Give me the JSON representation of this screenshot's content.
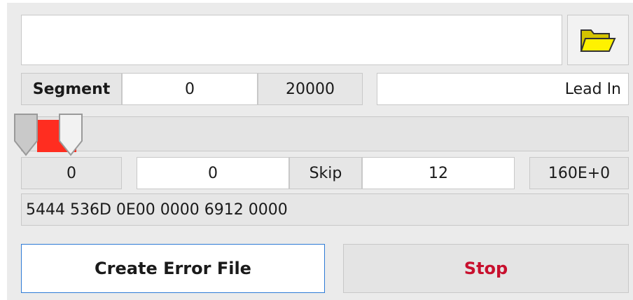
{
  "file": {
    "path_value": "",
    "browse_icon": "folder-open-icon"
  },
  "segment": {
    "label": "Segment",
    "start": "0",
    "end": "20000",
    "mode": "Lead In"
  },
  "slider": {
    "fill_color": "#ff2d20"
  },
  "position": {
    "value_a": "0",
    "value_b": "0",
    "skip_label": "Skip",
    "skip_count": "12",
    "rate": "160E+0"
  },
  "hex": {
    "value": "5444 536D 0E00 0000 6912 0000"
  },
  "actions": {
    "create_error_label": "Create Error File",
    "stop_label": "Stop",
    "stop_color": "#c8102e"
  }
}
